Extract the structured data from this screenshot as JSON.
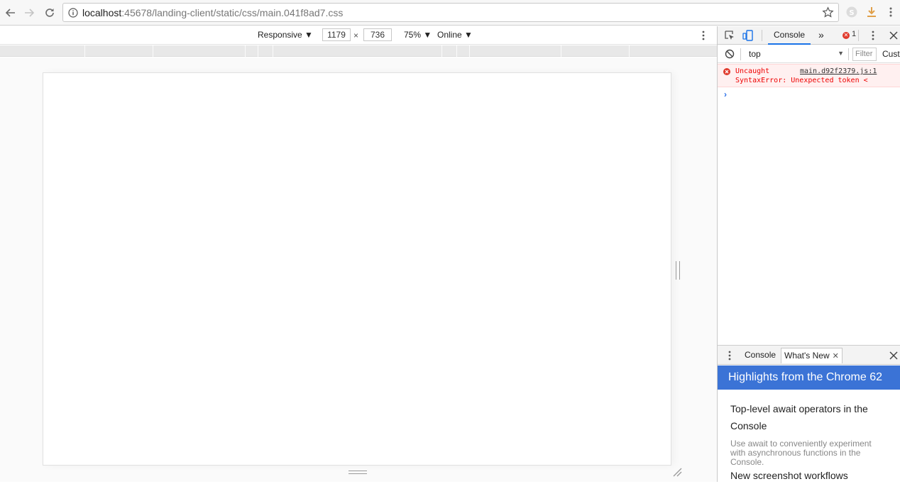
{
  "browser": {
    "url_host": "localhost",
    "url_path": ":45678/landing-client/static/css/main.041f8ad7.css"
  },
  "device_toolbar": {
    "mode": "Responsive",
    "width": "1179",
    "times": "×",
    "height": "736",
    "zoom": "75%",
    "throttle": "Online"
  },
  "devtools": {
    "active_tab": "Console",
    "overflow": "»",
    "error_count": "1",
    "context": "top",
    "filter_placeholder": "Filter",
    "custom_levels": "Cust",
    "message": {
      "line1": "Uncaught",
      "source": "main.d92f2379.js:1",
      "line2": "SyntaxError: Unexpected token <"
    },
    "prompt": "›",
    "drawer": {
      "tab_console": "Console",
      "tab_whats_new": "What's New",
      "banner": "Highlights from the Chrome 62",
      "items": [
        {
          "title": "Top-level await operators in the Console",
          "desc": "Use await to conveniently experiment with asynchronous functions in the Console."
        },
        {
          "title": "New screenshot workflows",
          "desc": ""
        }
      ]
    }
  },
  "colors": {
    "accent": "#1a73e8",
    "banner": "#3b73d6",
    "error": "#e00000",
    "error_bg": "#fff0f0"
  }
}
